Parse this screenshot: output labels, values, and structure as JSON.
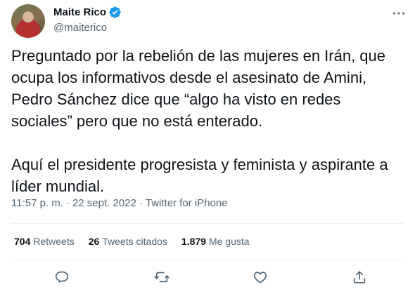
{
  "author": {
    "display_name": "Maite Rico",
    "handle": "@maiterico",
    "verified": true
  },
  "tweet": {
    "text": "Preguntado por la rebelión de las mujeres en Irán, que\nocupa los informativos desde el asesinato de Amini,\nPedro Sánchez dice que “algo ha visto en redes\nsociales” pero que no está enterado.\n\nAquí el presidente progresista y feminista y aspirante a\nlíder mundial.",
    "time": "11:57 p. m.",
    "separator": "·",
    "date": "22 sept. 2022",
    "source": "Twitter for iPhone"
  },
  "stats": {
    "retweets_count": "704",
    "retweets_label": "Retweets",
    "quotes_count": "26",
    "quotes_label": "Tweets citados",
    "likes_count": "1.879",
    "likes_label": "Me gusta"
  },
  "icons": {
    "more": "more-horizontal-icon",
    "reply": "reply-icon",
    "retweet": "retweet-icon",
    "like": "like-heart-icon",
    "share": "share-icon",
    "verified": "verified-badge-icon"
  },
  "colors": {
    "text_primary": "#0f1419",
    "text_secondary": "#536471",
    "verified_blue": "#1d9bf0",
    "divider": "#eff3f4"
  }
}
